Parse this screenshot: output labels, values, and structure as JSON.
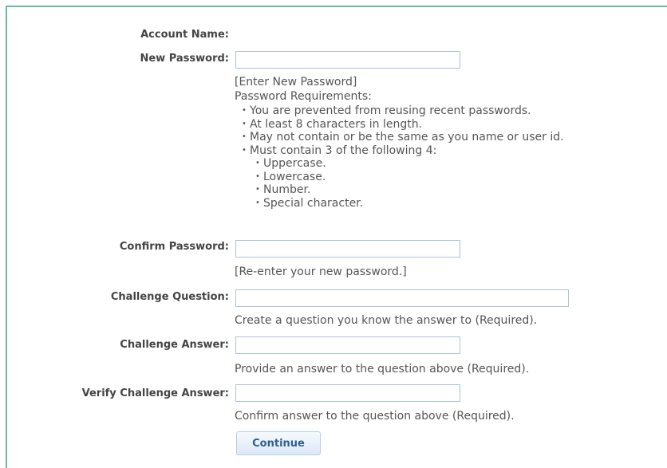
{
  "form": {
    "account_name": {
      "label": "Account Name:",
      "value": ""
    },
    "new_password": {
      "label": "New Password:",
      "value": "",
      "hint": "[Enter New Password]",
      "requirements_title": "Password Requirements:",
      "requirements": [
        "You are prevented from reusing recent passwords.",
        "At least 8 characters in length.",
        "May not contain or be the same as you name or user id.",
        "Must contain 3 of the following 4:"
      ],
      "sub_requirements": [
        "Uppercase.",
        "Lowercase.",
        "Number.",
        "Special character."
      ]
    },
    "confirm_password": {
      "label": "Confirm Password:",
      "value": "",
      "hint": "[Re-enter your new password.]"
    },
    "challenge_question": {
      "label": "Challenge Question:",
      "value": "",
      "hint": "Create a question you know the answer to (Required)."
    },
    "challenge_answer": {
      "label": "Challenge Answer:",
      "value": "",
      "hint": "Provide an answer to the question above (Required)."
    },
    "verify_challenge_answer": {
      "label": "Verify Challenge Answer:",
      "value": "",
      "hint": "Confirm answer to the question above (Required)."
    },
    "continue_label": "Continue"
  },
  "colors": {
    "frame_border": "#6bb89a",
    "input_border": "#a9c3de",
    "button_text": "#2e5f8f"
  }
}
